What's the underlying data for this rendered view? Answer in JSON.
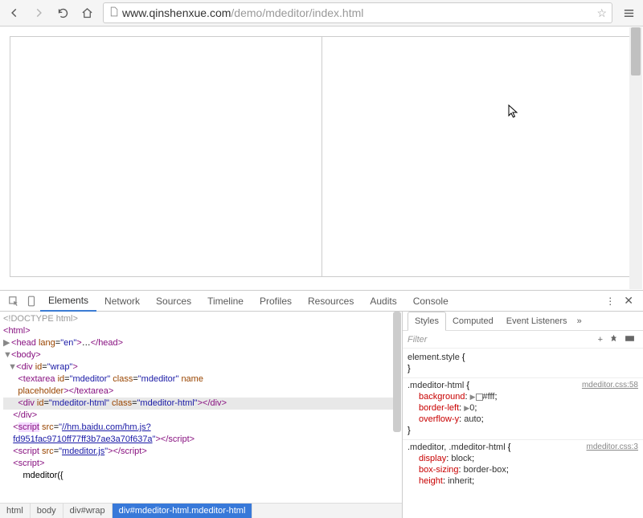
{
  "browser": {
    "url_plain": "www.qinshenxue.com",
    "url_path": "/demo/mdeditor/index.html"
  },
  "devtools": {
    "tabs": [
      "Elements",
      "Network",
      "Sources",
      "Timeline",
      "Profiles",
      "Resources",
      "Audits",
      "Console"
    ],
    "active_tab": "Elements",
    "elements": {
      "doctype": "<!DOCTYPE html>",
      "html_open": "<html>",
      "head_open": "<head lang=\"en\">",
      "head_ellipsis": "…",
      "head_close": "</head>",
      "body_open": "<body>",
      "wrap_open": "<div id=\"wrap\">",
      "textarea": "<textarea id=\"mdeditor\" class=\"mdeditor\" name placeholder></textarea>",
      "html_div": "<div id=\"mdeditor-html\" class=\"mdeditor-html\"></div>",
      "wrap_close": "</div>",
      "script1a": "<script src=\"",
      "script1b": "//hm.baidu.com/hm.js?fd951fac9710ff77ff3b7ae3a70f637a",
      "script1c": "\"></script>",
      "script2": "<script src=\"mdeditor.js\"></script>",
      "script3_open": "<script>",
      "script3_body": "mdeditor({"
    },
    "breadcrumb": [
      "html",
      "body",
      "div#wrap",
      "div#mdeditor-html.mdeditor-html"
    ],
    "styles": {
      "tabs": [
        "Styles",
        "Computed",
        "Event Listeners"
      ],
      "filter_placeholder": "Filter",
      "rules": [
        {
          "selector": "element.style",
          "origin": "",
          "props": []
        },
        {
          "selector": ".mdeditor-html",
          "origin": "mdeditor.css:58",
          "props": [
            {
              "name": "background",
              "value": "#fff",
              "swatch": true,
              "tri": true
            },
            {
              "name": "border-left",
              "value": "0",
              "tri": true
            },
            {
              "name": "overflow-y",
              "value": "auto"
            }
          ]
        },
        {
          "selector": ".mdeditor, .mdeditor-html",
          "origin": "mdeditor.css:3",
          "props": [
            {
              "name": "display",
              "value": "block"
            },
            {
              "name": "box-sizing",
              "value": "border-box"
            },
            {
              "name": "height",
              "value": "inherit"
            }
          ]
        }
      ]
    }
  }
}
